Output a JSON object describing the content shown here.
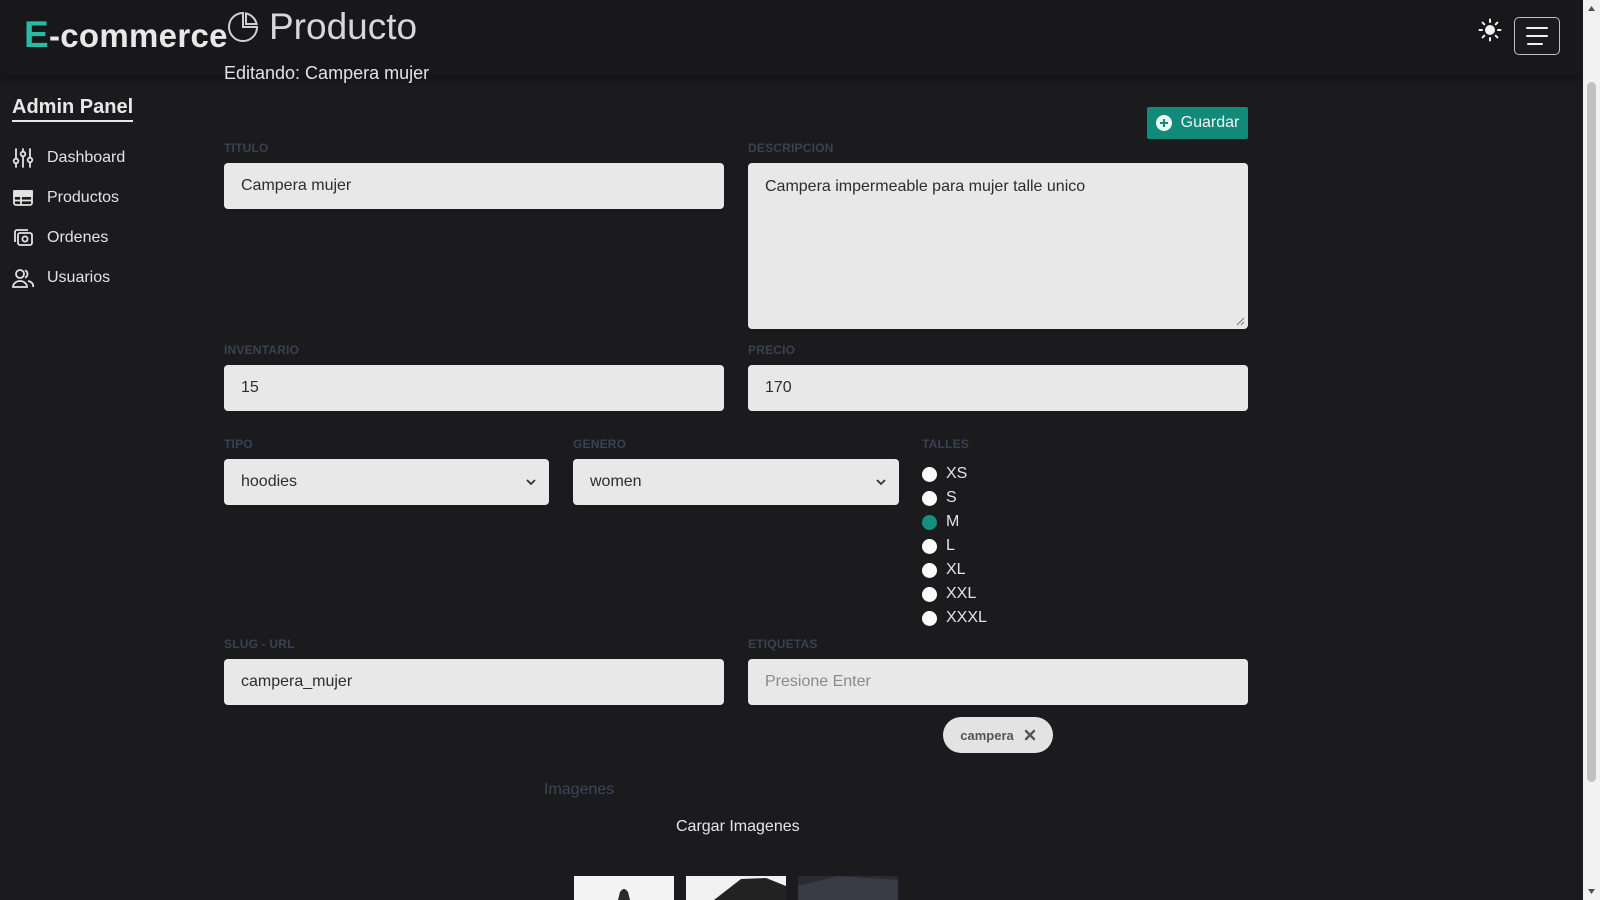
{
  "app": {
    "brand_first": "E",
    "brand_rest": "-commerce"
  },
  "header": {
    "title": "Producto",
    "subtitle": "Editando: Campera mujer"
  },
  "sidebar": {
    "title": "Admin Panel",
    "items": [
      {
        "label": "Dashboard",
        "icon": "sliders-icon"
      },
      {
        "label": "Productos",
        "icon": "table-icon"
      },
      {
        "label": "Ordenes",
        "icon": "orders-icon"
      },
      {
        "label": "Usuarios",
        "icon": "users-icon"
      }
    ]
  },
  "actions": {
    "save_label": "Guardar"
  },
  "form": {
    "titulo": {
      "label": "TITULO",
      "value": "Campera mujer"
    },
    "descripcion": {
      "label": "DESCRIPCION",
      "value": "Campera impermeable para mujer talle unico"
    },
    "inventario": {
      "label": "INVENTARIO",
      "value": "15"
    },
    "precio": {
      "label": "PRECIO",
      "value": "170"
    },
    "tipo": {
      "label": "TIPO",
      "value": "hoodies"
    },
    "genero": {
      "label": "GENERO",
      "value": "women"
    },
    "talles": {
      "label": "TALLES",
      "options": [
        "XS",
        "S",
        "M",
        "L",
        "XL",
        "XXL",
        "XXXL"
      ],
      "selected": "M"
    },
    "slug": {
      "label": "SLUG - URL",
      "value": "campera_mujer"
    },
    "etiquetas": {
      "label": "ETIQUETAS",
      "placeholder": "Presione Enter",
      "tags": [
        "campera"
      ]
    }
  },
  "images": {
    "label": "Imagenes",
    "upload_label": "Cargar Imagenes"
  },
  "colors": {
    "accent": "#128a7a",
    "brand_accent": "#2bb8a4",
    "background": "#1b1b1e"
  }
}
